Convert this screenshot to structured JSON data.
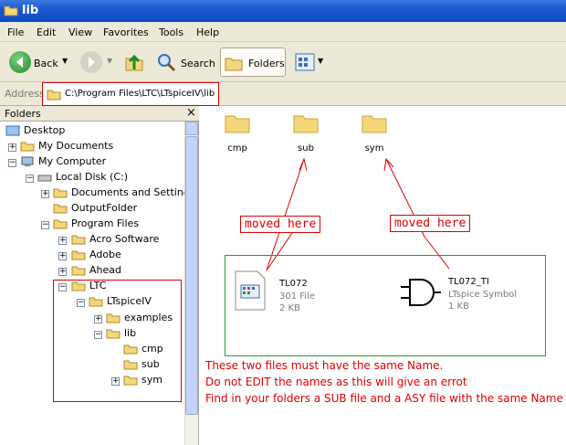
{
  "window": {
    "title": "lib"
  },
  "menu": [
    "File",
    "Edit",
    "View",
    "Favorites",
    "Tools",
    "Help"
  ],
  "toolbar": {
    "back": "Back",
    "search": "Search",
    "folders": "Folders"
  },
  "address": {
    "label": "Address",
    "value": "C:\\Program Files\\LTC\\LTspiceIV\\lib"
  },
  "folders_pane": {
    "title": "Folders",
    "close": "×"
  },
  "tree": {
    "desktop": "Desktop",
    "my_documents": "My Documents",
    "my_computer": "My Computer",
    "local_disk": "Local Disk (C:)",
    "docs_settings": "Documents and Settings",
    "output_folder": "OutputFolder",
    "program_files": "Program Files",
    "acro": "Acro Software",
    "adobe": "Adobe",
    "ahead": "Ahead",
    "ltc": "LTC",
    "ltspice": "LTspiceIV",
    "examples": "examples",
    "lib": "lib",
    "cmp": "cmp",
    "sub": "sub",
    "sym": "sym"
  },
  "content": {
    "folders": [
      "cmp",
      "sub",
      "sym"
    ],
    "file1": {
      "name": "TL072",
      "type": "301 File",
      "size": "2 KB"
    },
    "file2": {
      "name": "TL072_TI",
      "type": "LTspice Symbol",
      "size": "1 KB"
    }
  },
  "annotations": {
    "moved1": "moved here",
    "moved2": "moved here",
    "note1": "These two files must have the same Name.",
    "note2": "Do not EDIT the names as this will give an errot",
    "note3": "Find in your folders a SUB file and a ASY file with the same Name"
  }
}
